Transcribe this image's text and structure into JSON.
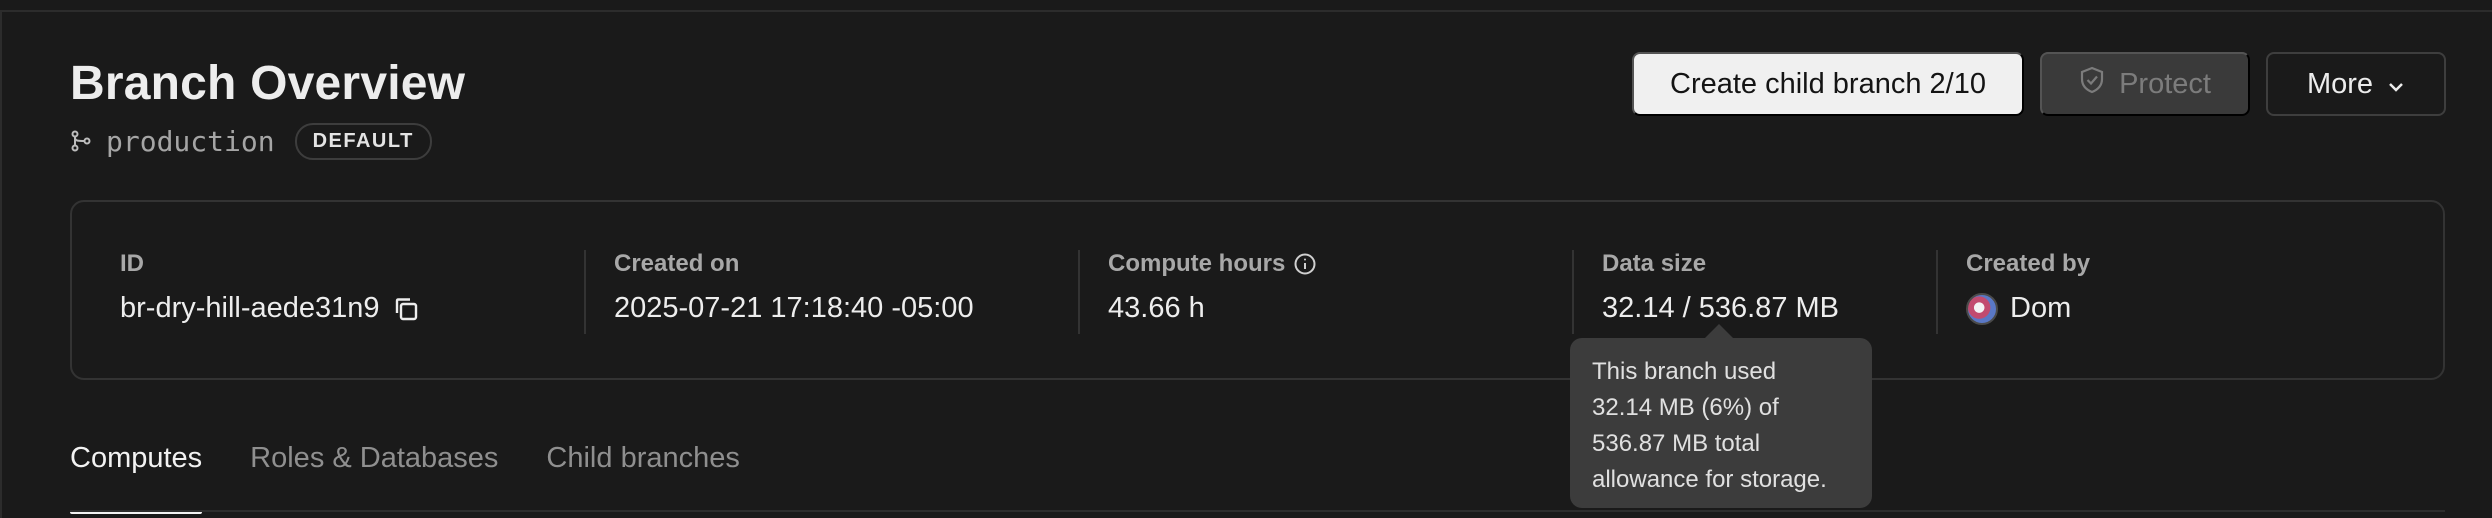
{
  "header": {
    "title": "Branch Overview",
    "branch_name": "production",
    "branch_badge": "DEFAULT"
  },
  "actions": {
    "create_child": "Create child branch 2/10",
    "protect": "Protect",
    "more": "More"
  },
  "info": {
    "id": {
      "label": "ID",
      "value": "br-dry-hill-aede31n9"
    },
    "created_on": {
      "label": "Created on",
      "value": "2025-07-21 17:18:40 -05:00"
    },
    "compute_hours": {
      "label": "Compute hours",
      "value": "43.66 h"
    },
    "data_size": {
      "label": "Data size",
      "value": "32.14 / 536.87 MB"
    },
    "created_by": {
      "label": "Created by",
      "value": "Dom"
    }
  },
  "tooltip": {
    "line1": "This branch used",
    "line2": "32.14 MB (6%) of",
    "line3": "536.87 MB total",
    "line4": "allowance for storage."
  },
  "tabs": [
    {
      "label": "Computes",
      "active": true
    },
    {
      "label": "Roles & Databases",
      "active": false
    },
    {
      "label": "Child branches",
      "active": false
    }
  ],
  "icons": {
    "branch": "git-branch-icon",
    "copy": "copy-icon",
    "info": "info-icon",
    "shield": "shield-icon",
    "chevron": "chevron-down-icon"
  }
}
